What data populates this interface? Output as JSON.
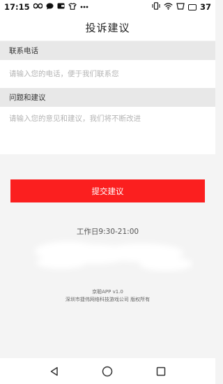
{
  "status_bar": {
    "time": "17:15",
    "battery": "37",
    "left_icons": [
      "infinity-icon",
      "chat-bubble-icon",
      "wallet-icon",
      "tshirt-icon",
      "more-dots-icon"
    ],
    "right_icons": [
      "vibrate-icon",
      "wifi-icon",
      "screen-icon",
      "battery-icon"
    ]
  },
  "header": {
    "title": "投诉建议"
  },
  "phone_section": {
    "label": "联系电话",
    "placeholder": "请输入您的电话，便于我们联系您",
    "value": ""
  },
  "issue_section": {
    "label": "问题和建议",
    "placeholder": "请输入您的意见和建议，我们将不断改进",
    "value": ""
  },
  "submit_button": {
    "label": "提交建议"
  },
  "work_hours": "工作日9:30-21:00",
  "footer": {
    "app_version": "京聪APP v1.0",
    "copyright": "深圳市捷伟网络科技游戏公司 版权所有"
  },
  "nav_bar": {
    "buttons": [
      "back-triangle-icon",
      "home-circle-icon",
      "recent-square-icon"
    ]
  },
  "colors": {
    "accent": "#fb1f1f",
    "section_bg": "#e8e8e8",
    "page_bg": "#f4f4f4"
  }
}
